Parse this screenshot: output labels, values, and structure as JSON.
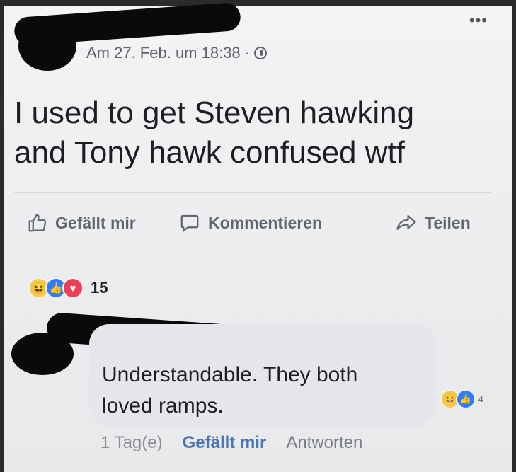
{
  "post": {
    "meta_text": "Am 27. Feb. um 18:38 ·",
    "more_label": "•••",
    "text_line1": "I used to get Steven hawking",
    "text_line2": "and Tony hawk confused wtf"
  },
  "actions": {
    "like_label": "Gefällt mir",
    "comment_label": "Kommentieren",
    "share_label": "Teilen"
  },
  "reactions": {
    "icons": [
      "haha-icon",
      "like-icon",
      "love-icon"
    ],
    "count": "15"
  },
  "comment": {
    "text_line1": "Understandable. They both",
    "text_line2": "loved ramps.",
    "reaction_count": "4",
    "time": "1 Tag(e)",
    "like_label": "Gefällt mir",
    "reply_label": "Antworten"
  },
  "colors": {
    "like_blue": "#2d7ff9",
    "love_red": "#ef3e57",
    "haha_yellow": "#f7c84b",
    "link_blue": "#4b74b7"
  }
}
